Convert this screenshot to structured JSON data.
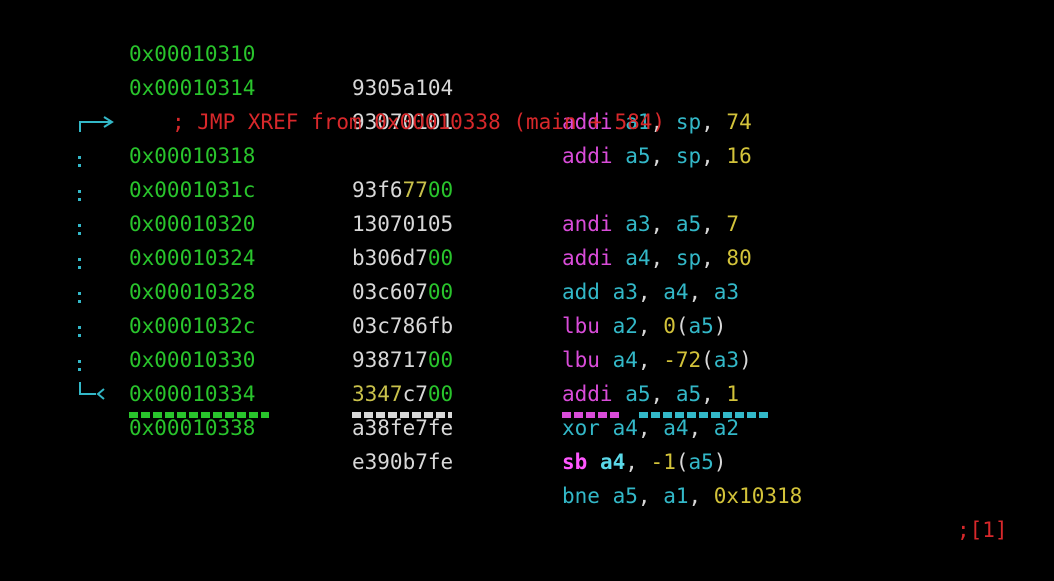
{
  "xref": "; JMP XREF from 0x00010338 (main + 584)",
  "rows": [
    {
      "addr": "0x00010310",
      "hex": "9305a104",
      "mn": "addi",
      "ops": [
        [
          "a1",
          "c"
        ],
        [
          ", ",
          "w"
        ],
        [
          "sp",
          "c"
        ],
        [
          ", ",
          "w"
        ],
        [
          "74",
          "n"
        ]
      ]
    },
    {
      "addr": "0x00010314",
      "hex": "93070101",
      "mn": "addi",
      "ops": [
        [
          "a5",
          "c"
        ],
        [
          ", ",
          "w"
        ],
        [
          "sp",
          "c"
        ],
        [
          ", ",
          "w"
        ],
        [
          "16",
          "n"
        ]
      ]
    },
    {
      "addr": "0x00010318",
      "hex": "93f67700",
      "mn": "andi",
      "ops": [
        [
          "a3",
          "c"
        ],
        [
          ", ",
          "w"
        ],
        [
          "a5",
          "c"
        ],
        [
          ", ",
          "w"
        ],
        [
          "7",
          "n"
        ]
      ],
      "flow": "->"
    },
    {
      "addr": "0x0001031c",
      "hex": "13070105",
      "mn": "addi",
      "ops": [
        [
          "a4",
          "c"
        ],
        [
          ", ",
          "w"
        ],
        [
          "sp",
          "c"
        ],
        [
          ", ",
          "w"
        ],
        [
          "80",
          "n"
        ]
      ]
    },
    {
      "addr": "0x00010320",
      "hex": "b306d700",
      "mn": "add",
      "mnc": "c",
      "ops": [
        [
          "a3",
          "c"
        ],
        [
          ", ",
          "w"
        ],
        [
          "a4",
          "c"
        ],
        [
          ", ",
          "w"
        ],
        [
          "a3",
          "c"
        ]
      ]
    },
    {
      "addr": "0x00010324",
      "hex": "03c60700",
      "mn": "lbu",
      "ops": [
        [
          "a2",
          "c"
        ],
        [
          ", ",
          "w"
        ],
        [
          "0",
          "n"
        ],
        [
          "(",
          "w"
        ],
        [
          "a5",
          "c"
        ],
        [
          ")",
          "w"
        ]
      ]
    },
    {
      "addr": "0x00010328",
      "hex": "03c786fb",
      "mn": "lbu",
      "ops": [
        [
          "a4",
          "c"
        ],
        [
          ", ",
          "w"
        ],
        [
          "-72",
          "n"
        ],
        [
          "(",
          "w"
        ],
        [
          "a3",
          "c"
        ],
        [
          ")",
          "w"
        ]
      ]
    },
    {
      "addr": "0x0001032c",
      "hex": "93871700",
      "mn": "addi",
      "ops": [
        [
          "a5",
          "c"
        ],
        [
          ", ",
          "w"
        ],
        [
          "a5",
          "c"
        ],
        [
          ", ",
          "w"
        ],
        [
          "1",
          "n"
        ]
      ]
    },
    {
      "addr": "0x00010330",
      "hex": "3347c700",
      "mn": "xor",
      "mnc": "c",
      "ops": [
        [
          "a4",
          "c"
        ],
        [
          ", ",
          "w"
        ],
        [
          "a4",
          "c"
        ],
        [
          ", ",
          "w"
        ],
        [
          "a2",
          "c"
        ]
      ]
    },
    {
      "addr": "0x00010334",
      "hex": "a38fe7fe",
      "mn": "sb",
      "mnc": "mb",
      "ops": [
        [
          "a4",
          "rb"
        ],
        [
          ", ",
          "w"
        ],
        [
          "-1",
          "n"
        ],
        [
          "(",
          "w"
        ],
        [
          "a5",
          "c"
        ],
        [
          ")",
          "w"
        ]
      ]
    },
    {
      "addr": "0x00010338",
      "hex": "e390b7fe",
      "mn": "bne",
      "mnc": "c",
      "ops": [
        [
          "a5",
          "c"
        ],
        [
          ", ",
          "w"
        ],
        [
          "a1",
          "c"
        ],
        [
          ", ",
          "w"
        ],
        [
          "0x10318",
          "n"
        ]
      ],
      "comment": ";[1]",
      "flow": "<"
    }
  ],
  "colors": {
    "address": "#29c42c",
    "opcode_bytes": "#d8d8d8",
    "mnemonic": "#d94cd9",
    "register": "#33b8c8",
    "immediate": "#d3c33a",
    "xref": "#d8282b",
    "flow_arrow": "#33b8c8"
  }
}
